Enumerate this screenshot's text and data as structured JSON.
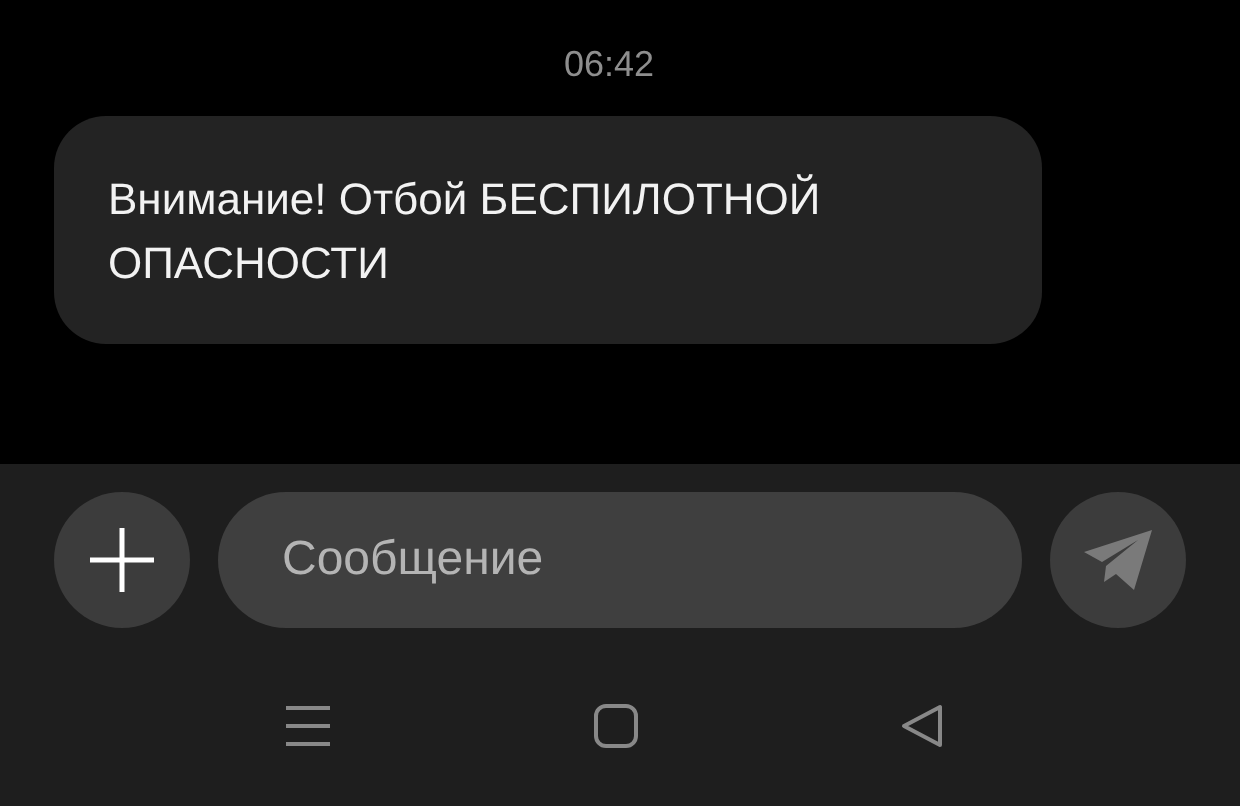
{
  "messages": [
    {
      "time": "06:42",
      "text": "Внимание! Отбой БЕСПИЛОТНОЙ ОПАСНОСТИ"
    }
  ],
  "composer": {
    "placeholder": "Сообщение"
  }
}
